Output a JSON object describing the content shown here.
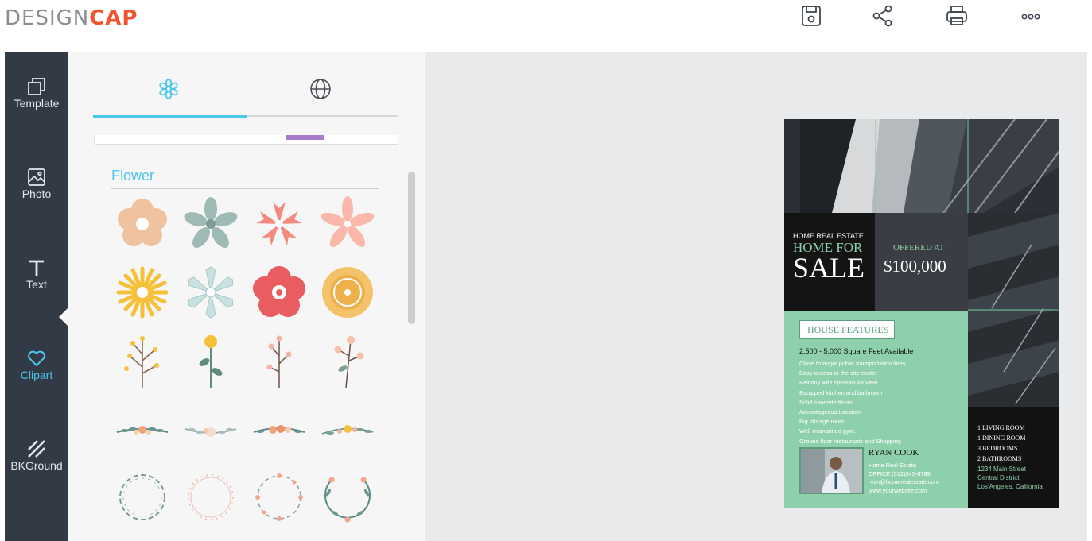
{
  "app": {
    "logo": {
      "prefix": "DESIGN",
      "suffix": "CAP"
    }
  },
  "header": {
    "actions": [
      {
        "name": "save-icon"
      },
      {
        "name": "share-icon"
      },
      {
        "name": "print-icon"
      },
      {
        "name": "more-icon"
      }
    ]
  },
  "leftnav": {
    "items": [
      {
        "label": "Template",
        "icon": "template-icon"
      },
      {
        "label": "Photo",
        "icon": "photo-icon"
      },
      {
        "label": "Text",
        "icon": "text-icon"
      },
      {
        "label": "Clipart",
        "icon": "heart-icon",
        "active": true
      },
      {
        "label": "BKGround",
        "icon": "background-icon"
      }
    ]
  },
  "clipart_panel": {
    "tabs": [
      {
        "icon": "flower-icon",
        "active": true
      },
      {
        "icon": "globe-icon",
        "active": false
      }
    ],
    "section_title": "Flower",
    "items": [
      "beige-flower",
      "sage-flower",
      "coral-flower",
      "pink-flower",
      "yellow-daisy",
      "pale-blue-flower",
      "red-flower",
      "orange-flower",
      "yellow-branch",
      "yellow-tulip-stem",
      "pink-berry-stem",
      "peach-blossom-stem",
      "blue-floral-garland",
      "beige-floral-garland",
      "orange-floral-garland",
      "yellow-floral-garland",
      "green-wreath",
      "pink-wreath",
      "peach-wreath",
      "leaf-wreath"
    ]
  },
  "poster": {
    "small_heading": "HOME REAL ESTATE",
    "heading_line1": "HOME FOR",
    "heading_line2": "SALE",
    "offered_label": "OFFERED AT",
    "price": "$100,000",
    "features_title": "HOUSE FEATURES",
    "area": "2,500 - 5,000 Square Feet Available",
    "features": [
      "Close to major public transportation lines",
      "Easy access to the city center",
      "Balcony with spectacular view",
      "Equipped kitchen and bathroom",
      "Solid concrete floors",
      "Advantageous Location",
      "Big storage room",
      "Well-maintained gym.",
      "Ground floor restaurants and Shopping"
    ],
    "agent_name": "RYAN COOK",
    "agent_lines": [
      "Home Real Estate",
      "OFFICE:(012)345-6789",
      "ryan@homerealestate.com",
      "www.yourwebsite.com"
    ],
    "rooms": [
      "1 LIVING ROOM",
      "1 DINING ROOM",
      "3 BEDROOMS",
      "2 BATHROOMS"
    ],
    "address": [
      "1234 Main Street",
      "Central District",
      "Los Angeles, California"
    ]
  },
  "colors": {
    "accent": "#4bc7ec",
    "logo_accent": "#f2542d",
    "sidebar": "#323a45",
    "poster_green": "#8fd0ac"
  }
}
